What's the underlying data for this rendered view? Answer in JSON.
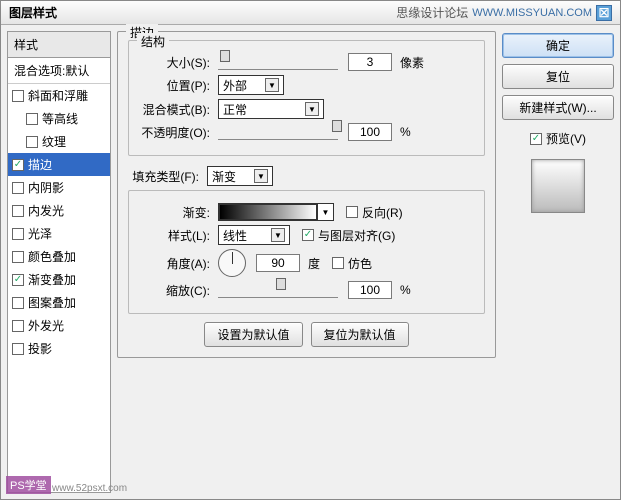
{
  "title": "图层样式",
  "titlebar_right": {
    "forum": "思缘设计论坛",
    "url": "WWW.MISSYUAN.COM"
  },
  "right": {
    "ok": "确定",
    "reset": "复位",
    "newstyle": "新建样式(W)...",
    "preview": "预览(V)"
  },
  "styles": {
    "header": "样式",
    "blend": "混合选项:默认",
    "items": [
      {
        "label": "斜面和浮雕",
        "checked": false,
        "indent": false
      },
      {
        "label": "等高线",
        "checked": false,
        "indent": true
      },
      {
        "label": "纹理",
        "checked": false,
        "indent": true
      },
      {
        "label": "描边",
        "checked": true,
        "indent": false,
        "selected": true
      },
      {
        "label": "内阴影",
        "checked": false,
        "indent": false
      },
      {
        "label": "内发光",
        "checked": false,
        "indent": false
      },
      {
        "label": "光泽",
        "checked": false,
        "indent": false
      },
      {
        "label": "颜色叠加",
        "checked": false,
        "indent": false
      },
      {
        "label": "渐变叠加",
        "checked": true,
        "indent": false
      },
      {
        "label": "图案叠加",
        "checked": false,
        "indent": false
      },
      {
        "label": "外发光",
        "checked": false,
        "indent": false
      },
      {
        "label": "投影",
        "checked": false,
        "indent": false
      }
    ]
  },
  "stroke": {
    "group_label": "描边",
    "structure_label": "结构",
    "size_label": "大小(S):",
    "size_val": "3",
    "size_unit": "像素",
    "position_label": "位置(P):",
    "position_val": "外部",
    "blendmode_label": "混合模式(B):",
    "blendmode_val": "正常",
    "opacity_label": "不透明度(O):",
    "opacity_val": "100",
    "opacity_unit": "%",
    "filltype_label": "填充类型(F):",
    "filltype_val": "渐变",
    "gradient_label": "渐变:",
    "reverse_label": "反向(R)",
    "style2_label": "样式(L):",
    "style2_val": "线性",
    "align_label": "与图层对齐(G)",
    "angle_label": "角度(A):",
    "angle_val": "90",
    "angle_unit": "度",
    "dither_label": "仿色",
    "scale_label": "缩放(C):",
    "scale_val": "100",
    "scale_unit": "%",
    "setdefault": "设置为默认值",
    "resetdefault": "复位为默认值"
  },
  "watermark": {
    "a": "PS学堂",
    "b": "www.52psxt.com"
  }
}
